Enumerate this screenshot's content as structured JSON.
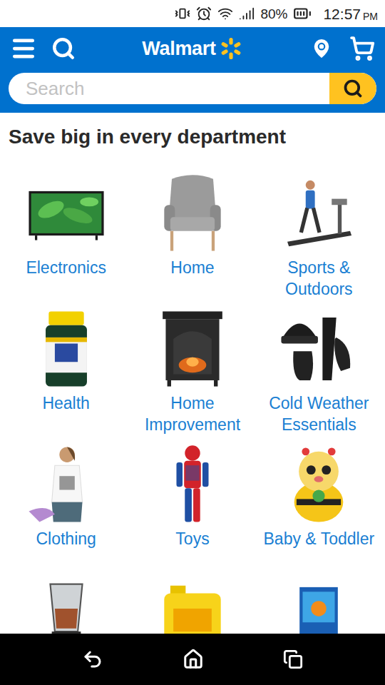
{
  "status_bar": {
    "battery": "80%",
    "time": "12:57",
    "period": "PM"
  },
  "header": {
    "logo": "Walmart",
    "search_placeholder": "Search"
  },
  "heading": "Save big in every department",
  "departments": [
    {
      "label": "Electronics"
    },
    {
      "label": "Home"
    },
    {
      "label": "Sports & Outdoors"
    },
    {
      "label": "Health"
    },
    {
      "label": "Home Improvement"
    },
    {
      "label": "Cold Weather Essentials"
    },
    {
      "label": "Clothing"
    },
    {
      "label": "Toys"
    },
    {
      "label": "Baby & Toddler"
    }
  ]
}
